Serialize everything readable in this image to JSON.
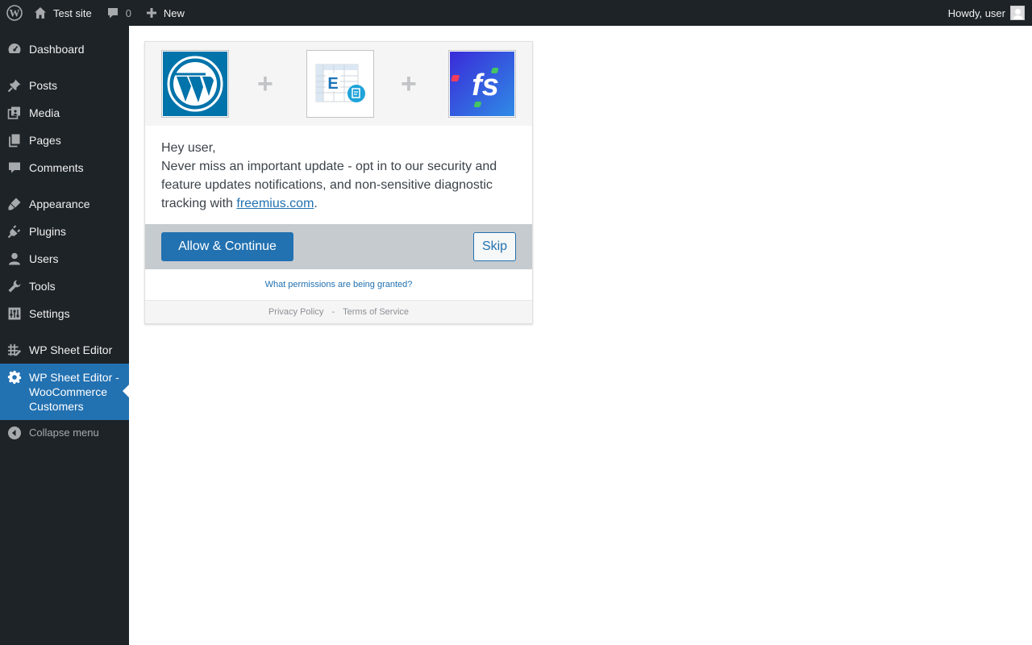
{
  "adminbar": {
    "site_name": "Test site",
    "comments_count": "0",
    "new_label": "New",
    "howdy": "Howdy, user"
  },
  "sidebar": {
    "items": [
      {
        "label": "Dashboard",
        "icon": "dashboard-icon"
      },
      {
        "label": "Posts",
        "icon": "pin-icon"
      },
      {
        "label": "Media",
        "icon": "media-icon"
      },
      {
        "label": "Pages",
        "icon": "pages-icon"
      },
      {
        "label": "Comments",
        "icon": "comment-icon"
      },
      {
        "label": "Appearance",
        "icon": "brush-icon"
      },
      {
        "label": "Plugins",
        "icon": "plug-icon"
      },
      {
        "label": "Users",
        "icon": "user-icon"
      },
      {
        "label": "Tools",
        "icon": "wrench-icon"
      },
      {
        "label": "Settings",
        "icon": "settings-icon"
      },
      {
        "label": "WP Sheet Editor",
        "icon": "grid-icon"
      },
      {
        "label": "WP Sheet Editor - WooCommerce Customers",
        "icon": "gear-icon"
      }
    ],
    "collapse_label": "Collapse menu"
  },
  "connect": {
    "greeting": "Hey user,",
    "message_before": "Never miss an important update - opt in to our security and feature updates notifications, and non-sensitive diagnostic tracking with ",
    "link_text": "freemius.com",
    "message_after": ".",
    "allow_label": "Allow & Continue ",
    "skip_label": "Skip",
    "permissions_link": "What permissions are being granted?",
    "privacy_label": "Privacy Policy",
    "separator": "-",
    "terms_label": "Terms of Service",
    "plugin_logo_letter": "E",
    "freemius_logo_text": "fs"
  },
  "colors": {
    "admin_dark": "#1d2327",
    "accent_blue": "#2271b1",
    "wp_logo_bg": "#0073aa"
  }
}
